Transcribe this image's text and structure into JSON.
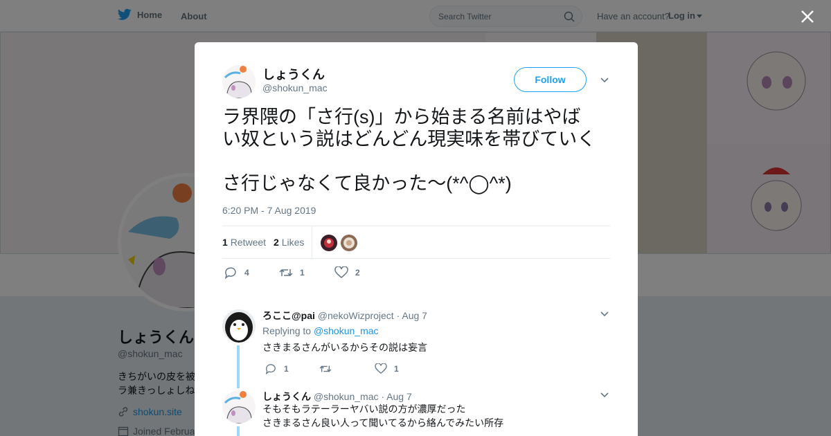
{
  "nav": {
    "home": "Home",
    "about": "About",
    "search_placeholder": "Search Twitter",
    "have_account": "Have an account?",
    "login": "Log in"
  },
  "profile": {
    "name": "しょうくん",
    "handle": "@shokun_mac",
    "bio_line1": "きちがいの皮を被",
    "bio_line2": "ラ兼きっしょしね",
    "link": "shokun.site",
    "joined": "Joined Februa"
  },
  "tweet": {
    "author_name": "しょうくん",
    "author_handle": "@shokun_mac",
    "follow_label": "Follow",
    "text_line1": "ラ界隈の「さ行(s)」から始まる名前はやば",
    "text_line2": "い奴という説はどんどん現実味を帯びていく",
    "text_line3": "さ行じゃなくて良かった〜(*^◯^*)",
    "timestamp": "6:20 PM - 7 Aug 2019",
    "retweet_count": "1",
    "retweet_label": "Retweet",
    "like_count": "2",
    "like_label": "Likes",
    "action_reply_count": "4",
    "action_retweet_count": "1",
    "action_like_count": "2"
  },
  "replies": [
    {
      "name": "ろここ@pai",
      "handle": "@nekoWizproject",
      "date": "· Aug 7",
      "replying_prefix": "Replying to",
      "replying_to": "@shokun_mac",
      "text_line1": "さきまるさんがいるからその説は妄言",
      "text_line2": "",
      "reply_count": "1",
      "retweet_count": "",
      "like_count": "1"
    },
    {
      "name": "しょうくん",
      "handle": "@shokun_mac",
      "date": "· Aug 7",
      "replying_prefix": "",
      "replying_to": "",
      "text_line1": "そもそもラテーラーヤバい説の方が濃厚だった",
      "text_line2": "さきまるさん良い人って聞いてるから絡んでみたい所存",
      "reply_count": "",
      "retweet_count": "",
      "like_count": ""
    }
  ],
  "colors": {
    "accent": "#1da1f2",
    "link": "#1b95e0",
    "muted": "#657786",
    "thread": "#a0d7f7"
  }
}
